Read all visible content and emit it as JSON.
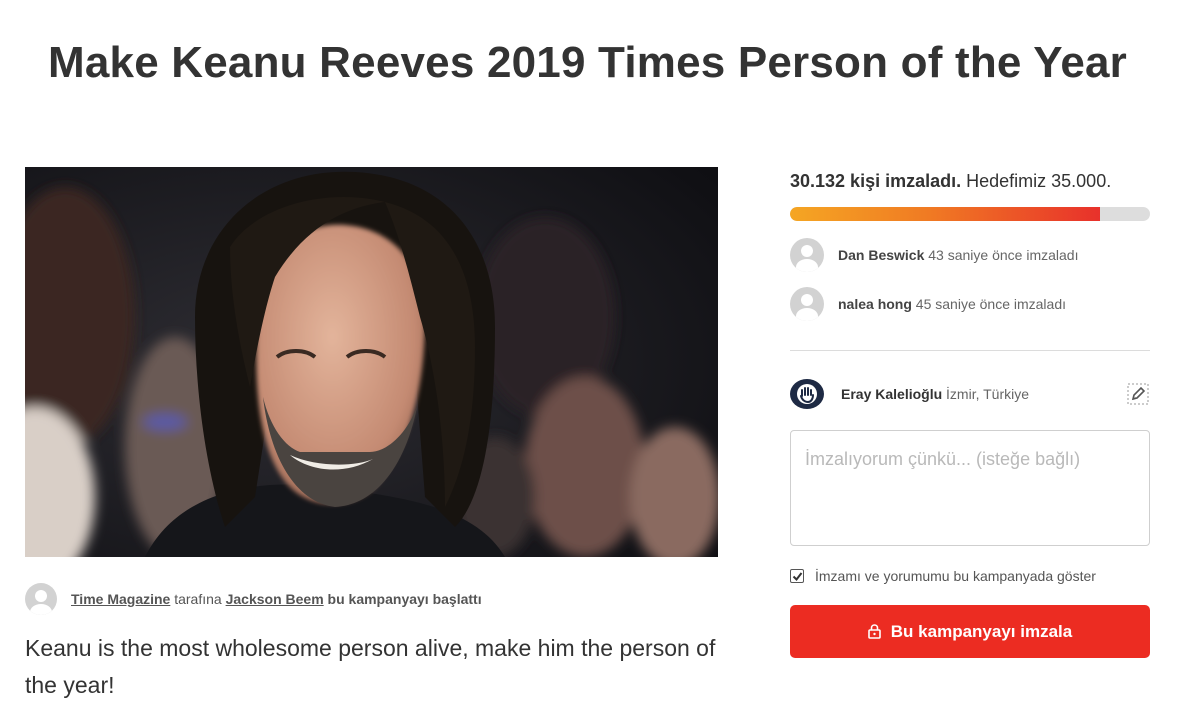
{
  "petition": {
    "title": "Make Keanu Reeves 2019 Times Person of the Year",
    "photo_alt": "Keanu Reeves",
    "starter": {
      "target": "Time Magazine",
      "target_suffix": "tarafına",
      "author": "Jackson Beem",
      "action": "bu kampanyayı başlattı"
    },
    "description": "Keanu is the most wholesome person alive, make him the person of the year!"
  },
  "signatures": {
    "count_label": "30.132 kişi imzaladı.",
    "goal_label": "Hedefimiz 35.000.",
    "progress_fraction": 0.861,
    "progress_colors": [
      "#f5a623",
      "#e8312b"
    ],
    "recent": [
      {
        "name": "Dan Beswick",
        "time": "43 saniye önce imzaladı"
      },
      {
        "name": "nalea hong",
        "time": "45 saniye önce imzaladı"
      }
    ]
  },
  "user": {
    "name": "Eray Kalelioğlu",
    "location": "İzmir, Türkiye",
    "logo_icon": "hand-logo-icon",
    "edit_icon": "pencil-edit-icon"
  },
  "form": {
    "reason_placeholder": "İmzalıyorum çünkü... (isteğe bağlı)",
    "reason_value": "",
    "consent_label": "İmzamı ve yorumumu bu kampanyada göster",
    "consent_checked": true,
    "sign_button_label": "Bu kampanyayı imzala",
    "sign_button_icon": "lock-icon",
    "accent_color": "#ec2c22"
  }
}
